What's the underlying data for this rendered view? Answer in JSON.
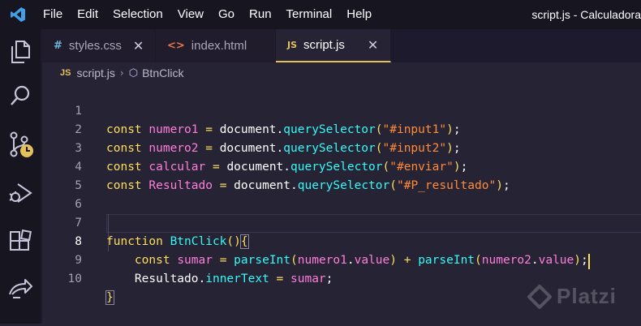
{
  "menu": [
    "File",
    "Edit",
    "Selection",
    "View",
    "Go",
    "Run",
    "Terminal",
    "Help"
  ],
  "window_title": "script.js - Calculadora",
  "tabs": [
    {
      "icon": "#",
      "label": "styles.css",
      "close": "✕",
      "icon_color": "#6fb5e0"
    },
    {
      "icon": "<>",
      "label": "index.html",
      "close": "",
      "icon_color": "#e8744e"
    },
    {
      "icon": "JS",
      "label": "script.js",
      "close": "✕",
      "icon_color": "#e6c15a"
    }
  ],
  "breadcrumb": {
    "file_icon": "JS",
    "file": "script.js",
    "symbol": "BtnClick"
  },
  "line_numbers": [
    "1",
    "2",
    "3",
    "4",
    "5",
    "6",
    "7",
    "8",
    "9",
    "10"
  ],
  "code": {
    "l1": {
      "kw": "const",
      "var": "numero1",
      "eq": "=",
      "obj": "document",
      "fn": "querySelector",
      "arg": "\"#input1\""
    },
    "l2": {
      "kw": "const",
      "var": "numero2",
      "eq": "=",
      "obj": "document",
      "fn": "querySelector",
      "arg": "\"#input2\""
    },
    "l3": {
      "kw": "const",
      "var": "calcular",
      "eq": "=",
      "obj": "document",
      "fn": "querySelector",
      "arg": "\"#enviar\""
    },
    "l4": {
      "kw": "const",
      "var": "Resultado",
      "eq": "=",
      "obj": "document",
      "fn": "querySelector",
      "arg": "\"#P_resultado\""
    },
    "l7": {
      "kw": "function",
      "fn": "BtnClick"
    },
    "l8": {
      "kw": "const",
      "var": "sumar",
      "eq": "=",
      "fn": "parseInt",
      "a1": "numero1",
      "p1": "value",
      "plus": "+",
      "a2": "numero2",
      "p2": "value"
    },
    "l9": {
      "obj": "Resultado",
      "prop": "innerText",
      "eq": "=",
      "val": "sumar"
    }
  },
  "watermark": "Platzi",
  "colors": {
    "background": "#262335",
    "keyword": "#fede5d",
    "variable": "#ff7edb",
    "function": "#36f9f6",
    "string": "#ff8b39"
  }
}
